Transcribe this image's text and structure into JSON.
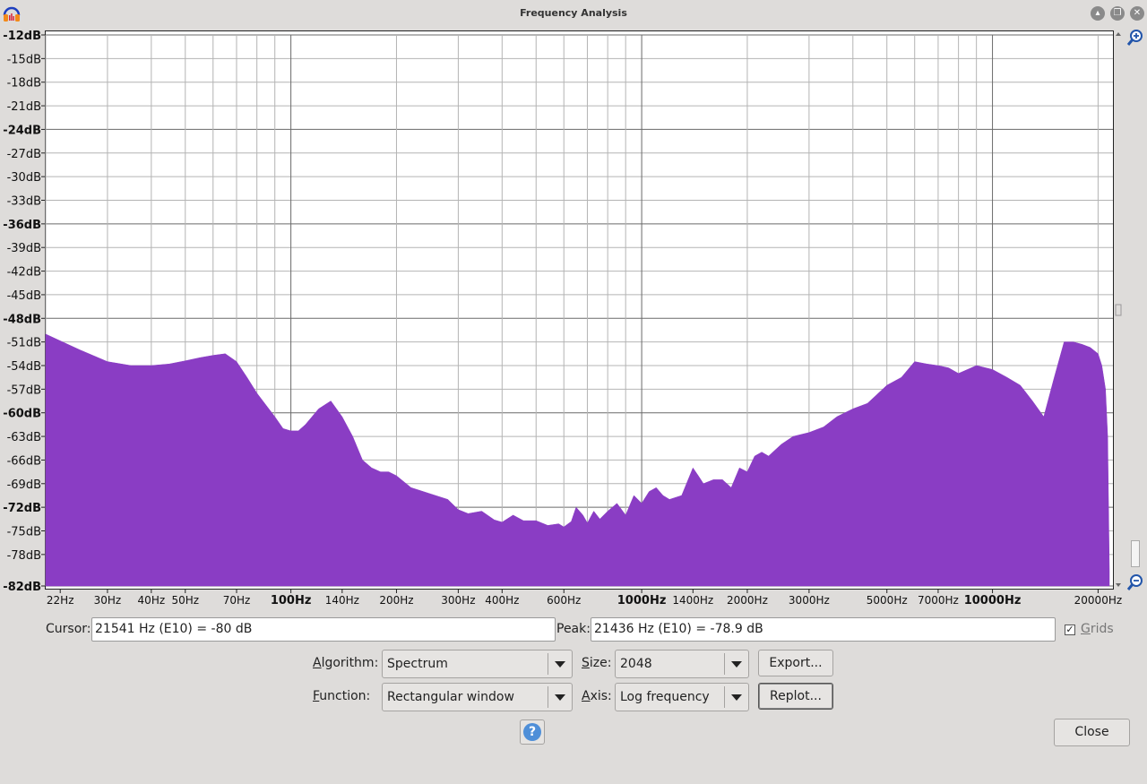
{
  "window": {
    "title": "Frequency Analysis"
  },
  "chart_data": {
    "type": "area",
    "title": "",
    "xlabel": "",
    "ylabel": "",
    "x_scale": "log",
    "xlim": [
      20,
      22050
    ],
    "ylim": [
      -82,
      -12
    ],
    "grid": true,
    "fill_color": "#8a3dc4",
    "y_ticks": [
      {
        "label": "-12dB",
        "value": -12,
        "major": true
      },
      {
        "label": "-15dB",
        "value": -15,
        "major": false
      },
      {
        "label": "-18dB",
        "value": -18,
        "major": false
      },
      {
        "label": "-21dB",
        "value": -21,
        "major": false
      },
      {
        "label": "-24dB",
        "value": -24,
        "major": true
      },
      {
        "label": "-27dB",
        "value": -27,
        "major": false
      },
      {
        "label": "-30dB",
        "value": -30,
        "major": false
      },
      {
        "label": "-33dB",
        "value": -33,
        "major": false
      },
      {
        "label": "-36dB",
        "value": -36,
        "major": true
      },
      {
        "label": "-39dB",
        "value": -39,
        "major": false
      },
      {
        "label": "-42dB",
        "value": -42,
        "major": false
      },
      {
        "label": "-45dB",
        "value": -45,
        "major": false
      },
      {
        "label": "-48dB",
        "value": -48,
        "major": true
      },
      {
        "label": "-51dB",
        "value": -51,
        "major": false
      },
      {
        "label": "-54dB",
        "value": -54,
        "major": false
      },
      {
        "label": "-57dB",
        "value": -57,
        "major": false
      },
      {
        "label": "-60dB",
        "value": -60,
        "major": true
      },
      {
        "label": "-63dB",
        "value": -63,
        "major": false
      },
      {
        "label": "-66dB",
        "value": -66,
        "major": false
      },
      {
        "label": "-69dB",
        "value": -69,
        "major": false
      },
      {
        "label": "-72dB",
        "value": -72,
        "major": true
      },
      {
        "label": "-75dB",
        "value": -75,
        "major": false
      },
      {
        "label": "-78dB",
        "value": -78,
        "major": false
      },
      {
        "label": "-82dB",
        "value": -82,
        "major": true
      }
    ],
    "x_ticks": [
      {
        "label": "22Hz",
        "value": 22,
        "major": false
      },
      {
        "label": "30Hz",
        "value": 30,
        "major": false
      },
      {
        "label": "40Hz",
        "value": 40,
        "major": false
      },
      {
        "label": "50Hz",
        "value": 50,
        "major": false
      },
      {
        "label": "70Hz",
        "value": 70,
        "major": false
      },
      {
        "label": "100Hz",
        "value": 100,
        "major": true
      },
      {
        "label": "140Hz",
        "value": 140,
        "major": false
      },
      {
        "label": "200Hz",
        "value": 200,
        "major": false
      },
      {
        "label": "300Hz",
        "value": 300,
        "major": false
      },
      {
        "label": "400Hz",
        "value": 400,
        "major": false
      },
      {
        "label": "600Hz",
        "value": 600,
        "major": false
      },
      {
        "label": "1000Hz",
        "value": 1000,
        "major": true
      },
      {
        "label": "1400Hz",
        "value": 1400,
        "major": false
      },
      {
        "label": "2000Hz",
        "value": 2000,
        "major": false
      },
      {
        "label": "3000Hz",
        "value": 3000,
        "major": false
      },
      {
        "label": "5000Hz",
        "value": 5000,
        "major": false
      },
      {
        "label": "7000Hz",
        "value": 7000,
        "major": false
      },
      {
        "label": "10000Hz",
        "value": 10000,
        "major": true
      },
      {
        "label": "20000Hz",
        "value": 20000,
        "major": false
      }
    ],
    "series": [
      {
        "x": [
          20,
          25,
          30,
          35,
          40,
          45,
          50,
          55,
          60,
          65,
          70,
          75,
          80,
          90,
          95,
          100,
          105,
          110,
          120,
          130,
          140,
          150,
          160,
          170,
          180,
          190,
          200,
          220,
          250,
          280,
          300,
          320,
          350,
          380,
          400,
          430,
          460,
          500,
          540,
          580,
          600,
          630,
          650,
          680,
          700,
          730,
          760,
          800,
          850,
          900,
          950,
          1000,
          1050,
          1100,
          1150,
          1200,
          1300,
          1400,
          1450,
          1500,
          1600,
          1700,
          1800,
          1900,
          2000,
          2100,
          2200,
          2300,
          2500,
          2700,
          3000,
          3300,
          3600,
          4000,
          4400,
          5000,
          5500,
          6000,
          6500,
          7000,
          7500,
          8000,
          9000,
          10000,
          11000,
          12000,
          13000,
          14000,
          15000,
          16000,
          17000,
          18000,
          19000,
          20000,
          20500,
          21000,
          21300,
          21541
        ],
        "y": [
          -50,
          -52,
          -53.5,
          -54,
          -54,
          -53.8,
          -53.4,
          -53,
          -52.7,
          -52.5,
          -53.5,
          -55.5,
          -57.5,
          -60.5,
          -62,
          -62.3,
          -62.3,
          -61.5,
          -59.5,
          -58.5,
          -60.5,
          -63,
          -66,
          -67,
          -67.5,
          -67.5,
          -68,
          -69.5,
          -70.3,
          -71,
          -72.3,
          -72.8,
          -72.5,
          -73.6,
          -73.9,
          -73,
          -73.7,
          -73.7,
          -74.3,
          -74.1,
          -74.5,
          -73.8,
          -72,
          -73,
          -74,
          -72.5,
          -73.5,
          -72.5,
          -71.5,
          -73,
          -70.5,
          -71.5,
          -70,
          -69.5,
          -70.5,
          -71,
          -70.5,
          -67,
          -68,
          -69,
          -68.5,
          -68.5,
          -69.5,
          -67,
          -67.5,
          -65.5,
          -65,
          -65.5,
          -64,
          -63,
          -62.5,
          -61.8,
          -60.5,
          -59.5,
          -58.8,
          -56.5,
          -55.5,
          -53.5,
          -53.8,
          -54,
          -54.3,
          -55,
          -54,
          -54.5,
          -55.5,
          -56.5,
          -58.5,
          -60.5,
          -55.5,
          -51,
          -51,
          -51.3,
          -51.7,
          -52.5,
          -54,
          -57,
          -63,
          -80
        ]
      }
    ]
  },
  "cursor": {
    "label": "Cursor:",
    "value": "21541 Hz (E10) = -80 dB"
  },
  "peak": {
    "label": "Peak:",
    "value": "21436 Hz (E10) = -78.9 dB"
  },
  "grids": {
    "label": "Grids",
    "checked": true,
    "check_glyph": "✓"
  },
  "algorithm": {
    "label": "Algorithm:",
    "value": "Spectrum"
  },
  "size": {
    "label": "Size:",
    "value": "2048"
  },
  "function": {
    "label": "Function:",
    "value": "Rectangular window"
  },
  "axis": {
    "label": "Axis:",
    "value": "Log frequency"
  },
  "buttons": {
    "export": "Export...",
    "replot": "Replot...",
    "close": "Close",
    "help": "?"
  },
  "icons": {
    "app": "headphones-icon",
    "zoom_in": "zoom-in-icon",
    "zoom_out": "zoom-out-icon",
    "minimize": "minimize-icon",
    "maximize": "maximize-icon",
    "close": "close-icon"
  }
}
